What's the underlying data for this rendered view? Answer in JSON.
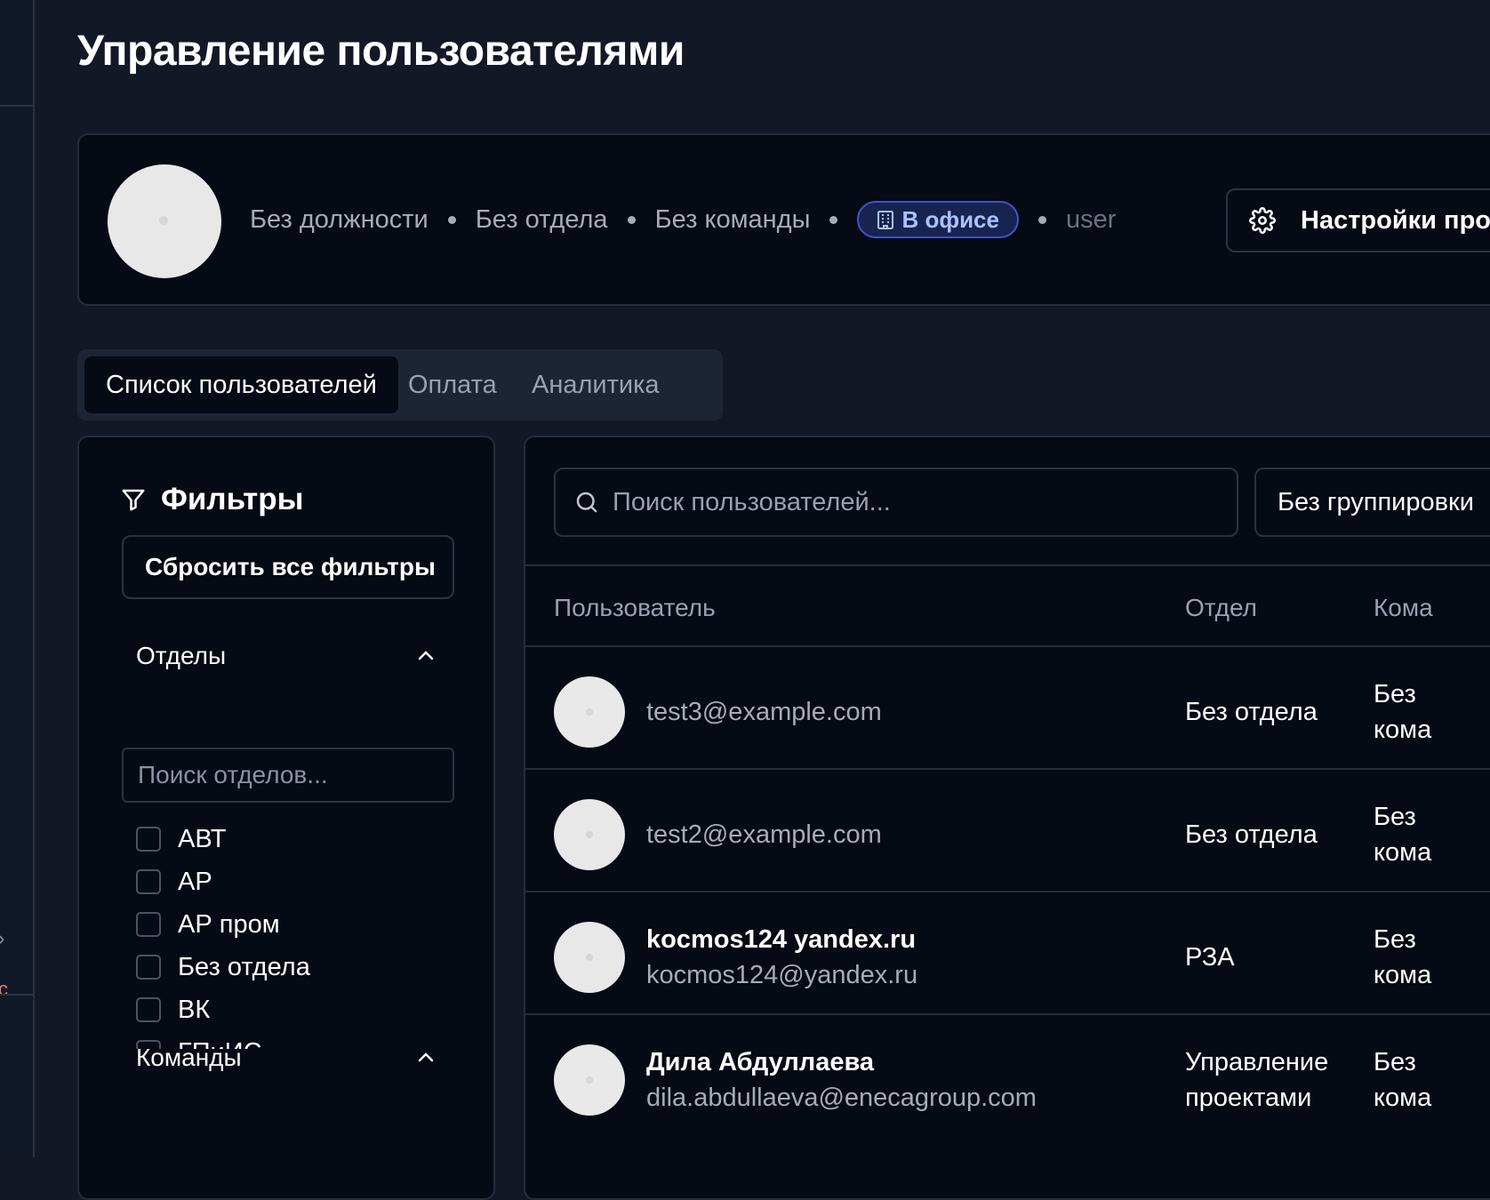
{
  "page": {
    "title": "Управление пользователями"
  },
  "profile": {
    "position": "Без должности",
    "department": "Без отдела",
    "team": "Без команды",
    "location_badge": "В офисе",
    "role": "user",
    "settings_button": "Настройки профи"
  },
  "tabs": [
    {
      "label": "Список пользователей",
      "active": true
    },
    {
      "label": "Оплата",
      "active": false
    },
    {
      "label": "Аналитика",
      "active": false
    }
  ],
  "filters": {
    "title": "Фильтры",
    "reset_label": "Сбросить все фильтры",
    "departments": {
      "title": "Отделы",
      "search_placeholder": "Поиск отделов...",
      "items": [
        "АВТ",
        "АР",
        "АР пром",
        "Без отдела",
        "ВК",
        "ГПиИС"
      ]
    },
    "teams": {
      "title": "Команды"
    }
  },
  "users_table": {
    "search_placeholder": "Поиск пользователей...",
    "grouping": "Без группировки",
    "columns": [
      "Пользователь",
      "Отдел",
      "Кома"
    ],
    "rows": [
      {
        "name": "",
        "email": "test3@example.com",
        "department": "Без отдела",
        "team": "Без кома"
      },
      {
        "name": "",
        "email": "test2@example.com",
        "department": "Без отдела",
        "team": "Без кома"
      },
      {
        "name": "kocmos124 yandex.ru",
        "email": "kocmos124@yandex.ru",
        "department": "РЗА",
        "team": "Без кома"
      },
      {
        "name": "Дила Абдуллаева",
        "email": "dila.abdullaeva@enecagroup.com",
        "department": "Управление проектами",
        "team": "Без кома"
      }
    ]
  },
  "colors": {
    "background": "#121826",
    "card": "#050a14",
    "badge": "#3b55c9"
  }
}
